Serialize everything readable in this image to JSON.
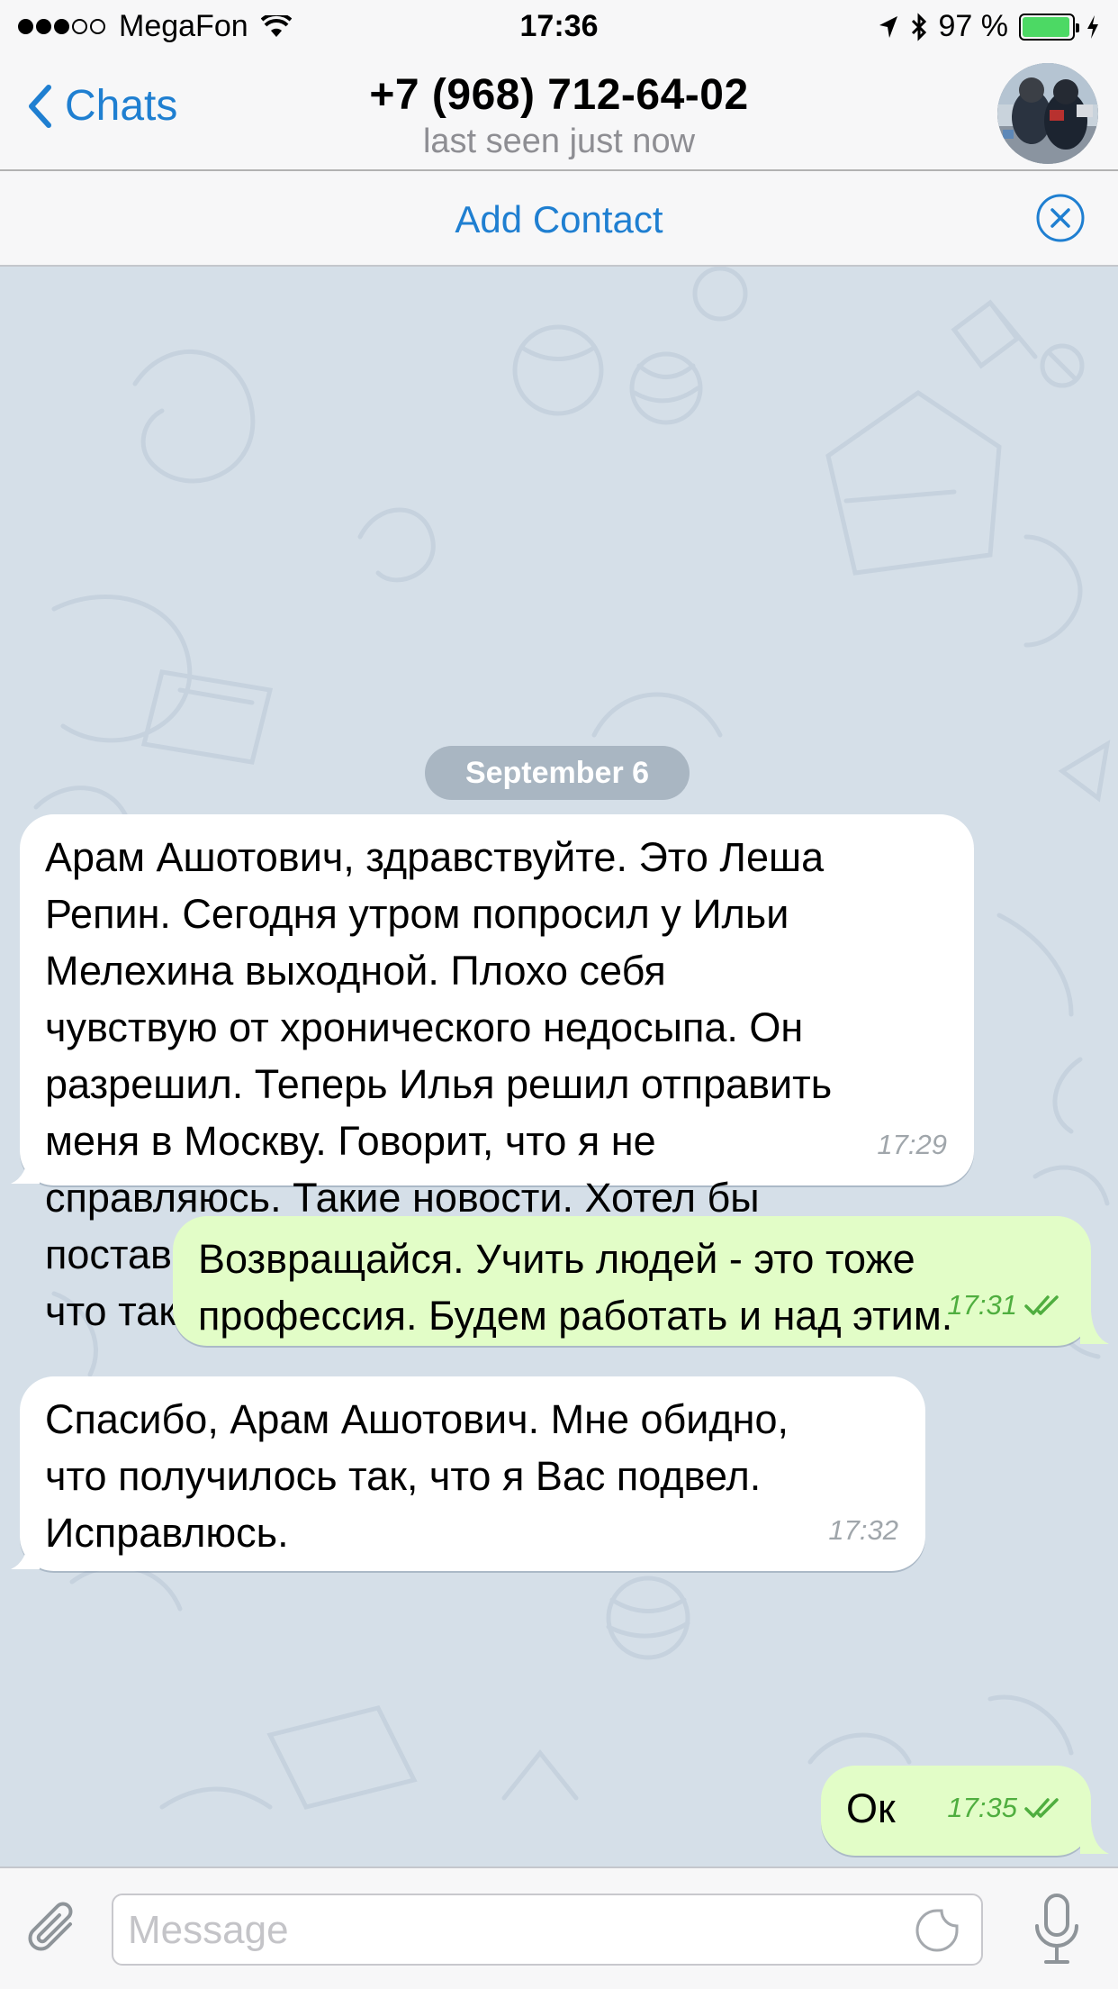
{
  "status_bar": {
    "carrier": "MegaFon",
    "time": "17:36",
    "battery_text": "97 %",
    "battery_level": 0.97,
    "signal_full": 3,
    "signal_total": 5
  },
  "nav": {
    "back_label": "Chats",
    "title": "+7 (968) 712-64-02",
    "subtitle": "last seen just now"
  },
  "add_contact": {
    "label": "Add Contact"
  },
  "chat": {
    "date": "September 6",
    "messages": [
      {
        "direction": "in",
        "text": "Арам Ашотович, здравствуйте. Это Леша\nРепин. Сегодня утром попросил у Ильи\nМелехина выходной. Плохо себя\nчувствую от хронического недосыпа. Он\nразрешил. Теперь Илья решил отправить\nменя в Москву. Говорит, что я не\nсправляюсь. Такие новости. Хотел бы\nпоставить Вас в известность. Мне жаль,\nчто так получилось.",
        "time": "17:29"
      },
      {
        "direction": "out",
        "text": "Возвращайся. Учить людей - это тоже\nпрофессия. Будем работать и над этим.",
        "time": "17:31",
        "status": "read"
      },
      {
        "direction": "in",
        "text": "Спасибо, Арам Ашотович. Мне обидно,\nчто получилось так, что я Вас подвел.\nИсправлюсь.",
        "time": "17:32"
      },
      {
        "direction": "out",
        "text": "Ок",
        "time": "17:35",
        "status": "read"
      }
    ]
  },
  "input": {
    "placeholder": "Message",
    "value": ""
  },
  "colors": {
    "accent": "#1f7fd1",
    "incoming_bubble": "#ffffff",
    "outgoing_bubble": "#e2fdc7",
    "outgoing_meta": "#4fae3f",
    "wallpaper": "#d5dfe8"
  },
  "icons": {
    "back": "chevron-left-icon",
    "close": "close-circle-icon",
    "attach": "paperclip-icon",
    "sticker": "sticker-icon",
    "mic": "microphone-icon",
    "read": "double-check-icon"
  }
}
